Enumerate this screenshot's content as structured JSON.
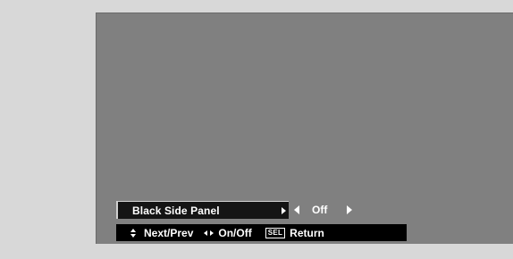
{
  "menu": {
    "item_label": "Black Side Panel",
    "value": "Off"
  },
  "help_bar": {
    "nav_label": "Next/Prev",
    "toggle_label": "On/Off",
    "sel_key": "SEL",
    "return_label": "Return"
  },
  "colors": {
    "background": "#d8d8d8",
    "screen": "#808080",
    "menu_bg": "#141414",
    "text": "#ffffff"
  },
  "icons": [
    "right-arrow-icon",
    "left-arrow-icon",
    "up-down-arrows-icon",
    "left-right-arrows-icon",
    "sel-key-icon"
  ]
}
